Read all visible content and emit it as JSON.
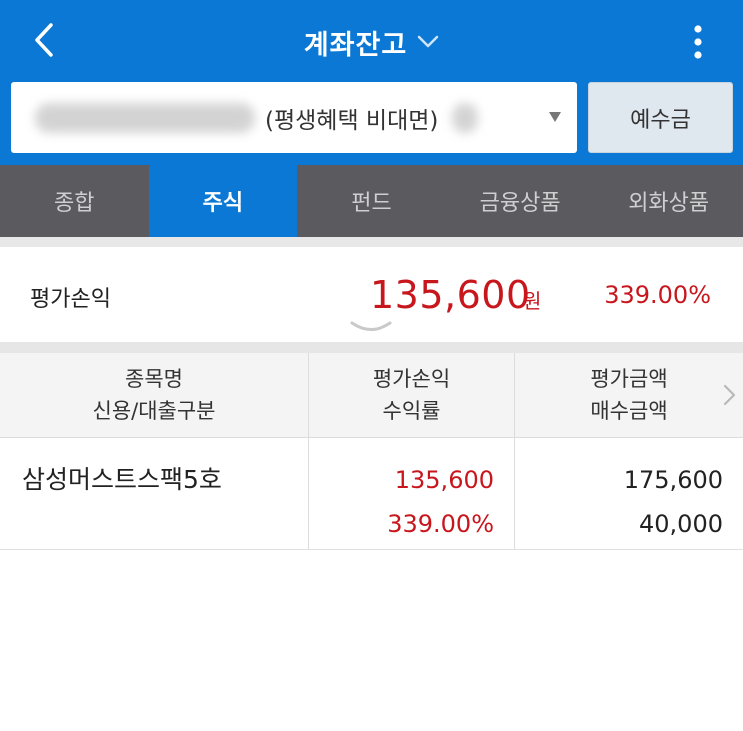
{
  "header": {
    "title": "계좌잔고",
    "colors": {
      "bar": "#0a78d4"
    }
  },
  "account": {
    "type_label": "(평생혜택 비대면)",
    "deposit_button": "예수금"
  },
  "tabs": [
    {
      "label": "종합",
      "active": false
    },
    {
      "label": "주식",
      "active": true
    },
    {
      "label": "펀드",
      "active": false
    },
    {
      "label": "금융상품",
      "active": false
    },
    {
      "label": "외화상품",
      "active": false
    }
  ],
  "summary": {
    "label": "평가손익",
    "value": "135,600",
    "unit": "원",
    "rate": "339.00%",
    "value_color": "#c8161d"
  },
  "table": {
    "headers": [
      {
        "line1": "종목명",
        "line2": "신용/대출구분"
      },
      {
        "line1": "평가손익",
        "line2": "수익률"
      },
      {
        "line1": "평가금액",
        "line2": "매수금액"
      }
    ],
    "rows": [
      {
        "name": "삼성머스트스팩5호",
        "profit": "135,600",
        "rate": "339.00%",
        "eval_amount": "175,600",
        "buy_amount": "40,000"
      }
    ]
  }
}
